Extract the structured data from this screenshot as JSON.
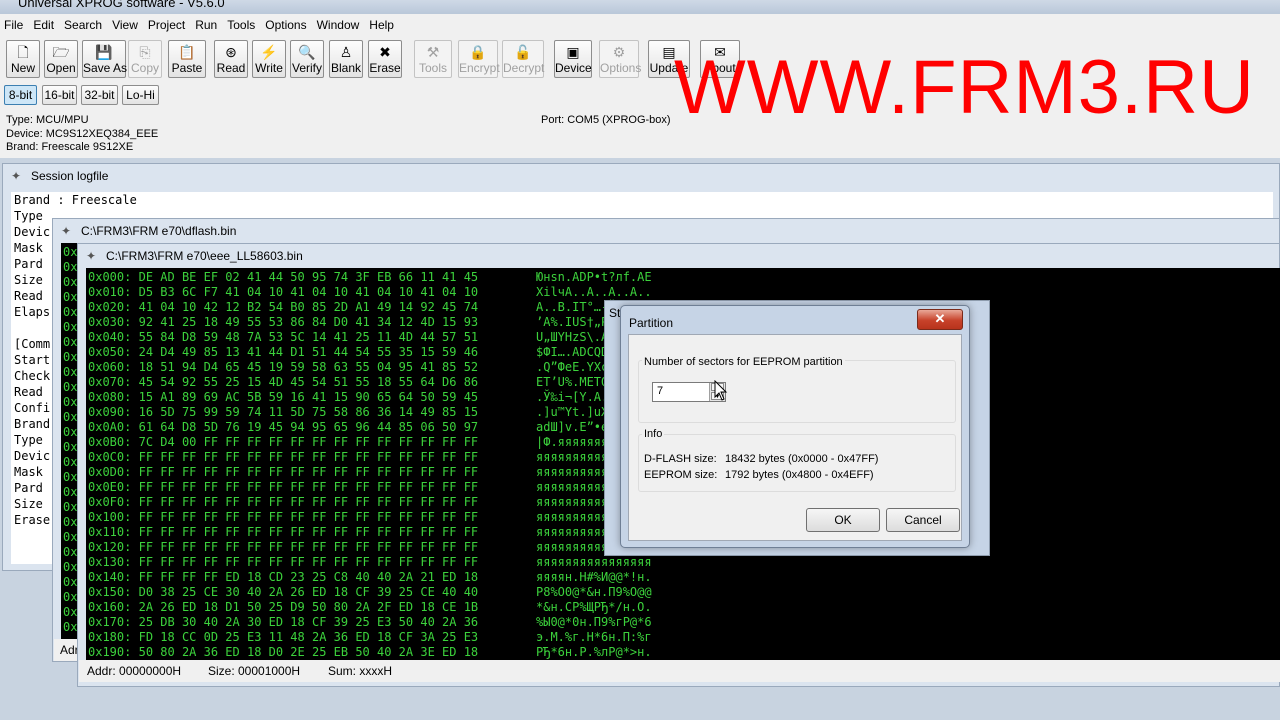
{
  "window": {
    "title": "Universal XPROG software - V5.6.0"
  },
  "menu": [
    "File",
    "Edit",
    "Search",
    "View",
    "Project",
    "Run",
    "Tools",
    "Options",
    "Window",
    "Help"
  ],
  "toolbar": [
    {
      "label": "New",
      "icon": "new-file-icon",
      "glyph": "🗋",
      "enabled": true
    },
    {
      "label": "Open",
      "icon": "open-icon",
      "glyph": "🗁",
      "enabled": true
    },
    {
      "label": "Save As",
      "icon": "save-icon",
      "glyph": "💾",
      "enabled": true
    },
    {
      "label": "Copy",
      "icon": "copy-icon",
      "glyph": "⎘",
      "enabled": false
    },
    {
      "label": "Paste",
      "icon": "paste-icon",
      "glyph": "📋",
      "enabled": true
    },
    {
      "label": "Read",
      "icon": "read-icon",
      "glyph": "⊛",
      "enabled": true
    },
    {
      "label": "Write",
      "icon": "write-icon",
      "glyph": "⚡",
      "enabled": true
    },
    {
      "label": "Verify",
      "icon": "verify-icon",
      "glyph": "🔍",
      "enabled": true
    },
    {
      "label": "Blank",
      "icon": "blank-icon",
      "glyph": "♙",
      "enabled": true
    },
    {
      "label": "Erase",
      "icon": "erase-icon",
      "glyph": "✖",
      "enabled": true
    },
    {
      "label": "Tools",
      "icon": "tools-icon",
      "glyph": "⚒",
      "enabled": false
    },
    {
      "label": "Encrypt",
      "icon": "lock-icon",
      "glyph": "🔒",
      "enabled": false
    },
    {
      "label": "Decrypt",
      "icon": "unlock-icon",
      "glyph": "🔓",
      "enabled": false
    },
    {
      "label": "Device",
      "icon": "chip-icon",
      "glyph": "▣",
      "enabled": true
    },
    {
      "label": "Options",
      "icon": "options-icon",
      "glyph": "⚙",
      "enabled": false
    },
    {
      "label": "Update",
      "icon": "update-icon",
      "glyph": "▤",
      "enabled": true
    },
    {
      "label": "About",
      "icon": "about-icon",
      "glyph": "✉",
      "enabled": true
    }
  ],
  "bits": [
    {
      "label": "8-bit",
      "active": true
    },
    {
      "label": "16-bit",
      "active": false
    },
    {
      "label": "32-bit",
      "active": false
    },
    {
      "label": "Lo-Hi",
      "active": false
    }
  ],
  "info": {
    "type": "Type: MCU/MPU",
    "device": "Device: MC9S12XEQ384_EEE",
    "brand": "Brand: Freescale 9S12XE",
    "port": "Port: COM5 (XPROG-box)"
  },
  "watermark": "WWW.FRM3.RU",
  "logfile": {
    "title": "Session logfile",
    "lines": [
      "Brand : Freescale",
      "Type",
      "Devic",
      "Mask",
      "Pard",
      "Size",
      "Read",
      "Elaps",
      "",
      "[Comm",
      "Start",
      "Check",
      "Read",
      "Confi",
      "Brand",
      "Type",
      "Devic",
      "Mask",
      "Pard",
      "Size",
      "Erase"
    ]
  },
  "dflash": {
    "title": "C:\\FRM3\\FRM e70\\dflash.bin",
    "addr_prefix": "0x",
    "status": "Adr"
  },
  "hexwin": {
    "title": "C:\\FRM3\\FRM e70\\eee_LL58603.bin",
    "rows": [
      {
        "addr": "0x000:",
        "hex": "DE AD BE EF 02 41 44 50 95 74 3F EB 66 11 41 45",
        "ascii": "Юнsn.ADP•t?лf.AE"
      },
      {
        "addr": "0x010:",
        "hex": "D5 B3 6C F7 41 04 10 41 04 10 41 04 10 41 04 10",
        "ascii": "XilчA..A..A..A.."
      },
      {
        "addr": "0x020:",
        "hex": "41 04 10 42 12 B2 54 B0 85 2D A1 49 14 92 45 74",
        "ascii": "A..B.IT°…-ЎI.’Et"
      },
      {
        "addr": "0x030:",
        "hex": "92 41 25 18 49 55 53 86 84 D0 41 34 12 4D 15 93",
        "ascii": "’A%.IUS†„РA4.M.“"
      },
      {
        "addr": "0x040:",
        "hex": "55 84 D8 59 48 7A 53 5C 14 41 25 11 4D 44 57 51",
        "ascii": "U„ШYHzS\\.A%.MDWQ"
      },
      {
        "addr": "0x050:",
        "hex": "24 D4 49 85 13 41 44 D1 51 44 54 55 35 15 59 46",
        "ascii": "$ФI….ADСQDTU5.YF"
      },
      {
        "addr": "0x060:",
        "hex": "18 51 94 D4 65 45 19 59 58 63 55 04 95 41 85 52",
        "ascii": ".Q”ФeE.YXcU.•A…R"
      },
      {
        "addr": "0x070:",
        "hex": "45 54 92 55 25 15 4D 45 54 51 55 18 55 64 D6 86",
        "ascii": "ET’U%.METQU.UdЦ†"
      },
      {
        "addr": "0x080:",
        "hex": "15 A1 89 69 AC 5B 59 16 41 15 90 65 64 50 59 45",
        "ascii": ".Ў‰i¬[Y.A.ђedPYE"
      },
      {
        "addr": "0x090:",
        "hex": "16 5D 75 99 59 74 11 5D 75 58 86 36 14 49 85 15",
        "ascii": ".]u™Yt.]uX†6.I…."
      },
      {
        "addr": "0x0A0:",
        "hex": "61 64 D8 5D 76 19 45 94 95 65 96 44 85 06 50 97",
        "ascii": "adШ]v.E”•e–D….P—"
      },
      {
        "addr": "0x0B0:",
        "hex": "7C D4 00 FF FF FF FF FF FF FF FF FF FF FF FF FF",
        "ascii": "|Ф.яяяяяяяяяяяяя"
      },
      {
        "addr": "0x0C0:",
        "hex": "FF FF FF FF FF FF FF FF FF FF FF FF FF FF FF FF",
        "ascii": "яяяяяяяяяяяяяяяя"
      },
      {
        "addr": "0x0D0:",
        "hex": "FF FF FF FF FF FF FF FF FF FF FF FF FF FF FF FF",
        "ascii": "яяяяяяяяяяяяяяяя"
      },
      {
        "addr": "0x0E0:",
        "hex": "FF FF FF FF FF FF FF FF FF FF FF FF FF FF FF FF",
        "ascii": "яяяяяяяяяяяяяяяя"
      },
      {
        "addr": "0x0F0:",
        "hex": "FF FF FF FF FF FF FF FF FF FF FF FF FF FF FF FF",
        "ascii": "яяяяяяяяяяяяяяяя"
      },
      {
        "addr": "0x100:",
        "hex": "FF FF FF FF FF FF FF FF FF FF FF FF FF FF FF FF",
        "ascii": "яяяяяяяяяяяяяяяя"
      },
      {
        "addr": "0x110:",
        "hex": "FF FF FF FF FF FF FF FF FF FF FF FF FF FF FF FF",
        "ascii": "яяяяяяяяяяяяяяяя"
      },
      {
        "addr": "0x120:",
        "hex": "FF FF FF FF FF FF FF FF FF FF FF FF FF FF FF FF",
        "ascii": "яяяяяяяяяяяяяяяя"
      },
      {
        "addr": "0x130:",
        "hex": "FF FF FF FF FF FF FF FF FF FF FF FF FF FF FF FF",
        "ascii": "яяяяяяяяяяяяяяяя"
      },
      {
        "addr": "0x140:",
        "hex": "FF FF FF FF ED 18 CD 23 25 C8 40 40 2A 21 ED 18",
        "ascii": "яяяян.Н#%И@@*!н."
      },
      {
        "addr": "0x150:",
        "hex": "D0 38 25 CE 30 40 2A 26 ED 18 CF 39 25 CE 40 40",
        "ascii": "Р8%О0@*&н.П9%О@@"
      },
      {
        "addr": "0x160:",
        "hex": "2A 26 ED 18 D1 50 25 D9 50 80 2A 2F ED 18 CE 1B",
        "ascii": "*&н.СР%ЩРЂ*/н.О."
      },
      {
        "addr": "0x170:",
        "hex": "25 DB 30 40 2A 30 ED 18 CF 39 25 E3 50 40 2A 36",
        "ascii": "%Ы0@*0н.П9%гР@*6"
      },
      {
        "addr": "0x180:",
        "hex": "FD 18 CC 0D 25 E3 11 48 2A 36 ED 18 CF 3A 25 E3",
        "ascii": "э.М.%г.H*6н.П:%г"
      },
      {
        "addr": "0x190:",
        "hex": "50 80 2A 36 ED 18 D0 2E 25 EB 50 40 2A 3E ED 18",
        "ascii": "РЂ*6н.Р.%лР@*>н."
      }
    ],
    "status": {
      "addr": "Addr: 00000000H",
      "size": "Size: 00001000H",
      "sum": "Sum: xxxxH"
    },
    "peek_title": "St"
  },
  "dialog": {
    "title": "Partition",
    "close": "✕",
    "sectors_label": "Number of sectors for EEPROM partition",
    "sectors_value": "7",
    "info_label": "Info",
    "dflash_label": "D-FLASH size:",
    "dflash_value": "18432 bytes (0x0000 - 0x47FF)",
    "eeprom_label": "EEPROM size:",
    "eeprom_value": "1792 bytes (0x4800 - 0x4EFF)",
    "ok": "OK",
    "cancel": "Cancel"
  }
}
